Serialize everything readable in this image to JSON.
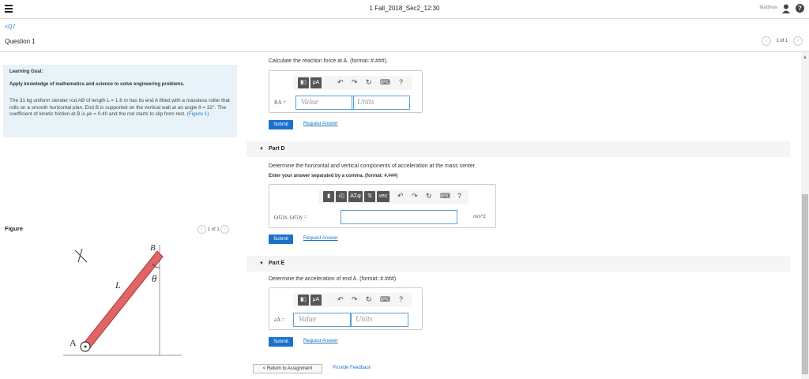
{
  "header": {
    "title": "1 Fall_2018_Sec2_12:30",
    "user": "Matthew"
  },
  "nav": {
    "back": "<Q7"
  },
  "question": {
    "title": "Question 1",
    "pager": "1 of 1"
  },
  "learning_goal": {
    "heading": "Learning Goal:",
    "apply": "Apply knowledge of mathematics and science to solve engineering problems.",
    "body": "The 31 kg uniform slender rod AB of length L = 1.6 m has its end A fitted with a massless roller that rolls on a smooth horizontal plan. End B is supported on the vertical wall at an angle θ = 32°. The coefficient of kinetic friction at B is μk = 0.40 and the rod starts to slip from rest.",
    "figure_link": "(Figure 1)"
  },
  "figure": {
    "heading": "Figure",
    "pager": "1 of 1",
    "labels": {
      "B": "B",
      "L": "L",
      "theta": "θ",
      "A": "A"
    }
  },
  "part_c": {
    "prompt": "Calculate the reaction force at A. (format: #.###).",
    "var_label": "RA =",
    "value_placeholder": "Value",
    "units_placeholder": "Units",
    "submit": "Submit",
    "request": "Request Answer"
  },
  "part_d": {
    "label": "Part D",
    "prompt": "Determine the horizontal and vertical components of acceleration at the mass center.",
    "prompt2": "Enter your answer separated by a comma. (format: #.###)",
    "var_label": "(aG)x, (aG)y =",
    "unit": "m/s^2",
    "submit": "Submit",
    "request": "Request Answer",
    "toolbar": {
      "sym": "ΑΣφ",
      "vec": "vec"
    }
  },
  "part_e": {
    "label": "Part E",
    "prompt": "Determine the acceleration of end A. (format: #.###).",
    "var_label": "aA =",
    "value_placeholder": "Value",
    "units_placeholder": "Units",
    "submit": "Submit",
    "request": "Request Answer"
  },
  "footer": {
    "back": "< Return to Assignment",
    "feedback": "Provide Feedback"
  },
  "toolbar_common": {
    "mu": "μA",
    "help": "?"
  }
}
